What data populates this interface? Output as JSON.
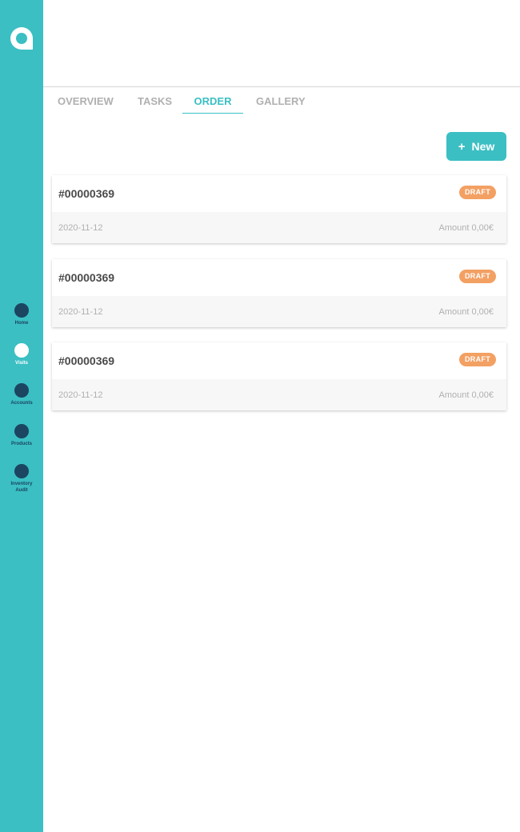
{
  "sidebar": {
    "logo_icon": "app-logo-icon",
    "items": [
      {
        "label": "Home",
        "active": false
      },
      {
        "label": "Visits",
        "active": true
      },
      {
        "label": "Accounts",
        "active": false
      },
      {
        "label": "Products",
        "active": false
      },
      {
        "label": "Inventory",
        "label2": "Audit",
        "active": false
      }
    ]
  },
  "tabs": [
    {
      "label": "OVERVIEW",
      "active": false
    },
    {
      "label": "TASKS",
      "active": false
    },
    {
      "label": "ORDER",
      "active": true
    },
    {
      "label": "GALLERY",
      "active": false
    }
  ],
  "new_button": {
    "icon": "plus-icon",
    "plus": "+",
    "label": "New"
  },
  "orders": [
    {
      "number": "#00000369",
      "status": "DRAFT",
      "date": "2020-11-12",
      "amount": "Amount 0,00€"
    },
    {
      "number": "#00000369",
      "status": "DRAFT",
      "date": "2020-11-12",
      "amount": "Amount 0,00€"
    },
    {
      "number": "#00000369",
      "status": "DRAFT",
      "date": "2020-11-12",
      "amount": "Amount 0,00€"
    }
  ],
  "colors": {
    "primary": "#3bbfc3",
    "sidebar_icon": "#1b4560",
    "draft_badge": "#f3a063",
    "muted_text": "#b0b0b0"
  }
}
